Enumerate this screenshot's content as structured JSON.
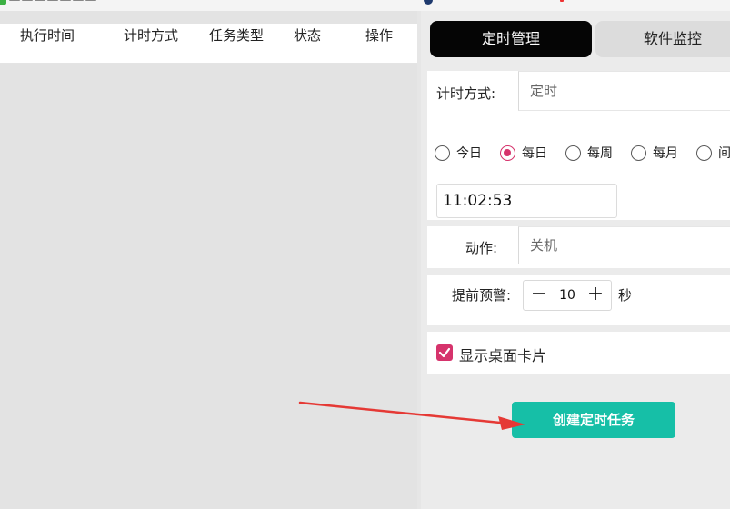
{
  "table": {
    "columns": [
      "执行时间",
      "计时方式",
      "任务类型",
      "状态",
      "操作"
    ]
  },
  "tabs": {
    "timer_manage": "定时管理",
    "software_monitor": "软件监控"
  },
  "form": {
    "timer_mode_label": "计时方式:",
    "timer_mode_value": "定时",
    "frequency_options": [
      "今日",
      "每日",
      "每周",
      "每月",
      "间"
    ],
    "frequency_selected": "每日",
    "time_value": "11:02:53",
    "action_label": "动作:",
    "action_value": "关机",
    "warning_label": "提前预警:",
    "warning_value": "10",
    "warning_minus": "−",
    "warning_plus": "+",
    "warning_unit": "秒",
    "show_card_label": "显示桌面卡片",
    "show_card_checked": true,
    "create_button": "创建定时任务"
  },
  "colors": {
    "accent_pink": "#d6336c",
    "create_button": "#16bfa7",
    "active_tab": "#050505",
    "arrow_red": "#e53935"
  },
  "icons": {
    "app_icon": "app-icon",
    "checkbox_check": "check-icon",
    "annotation_arrow": "arrow-icon"
  }
}
